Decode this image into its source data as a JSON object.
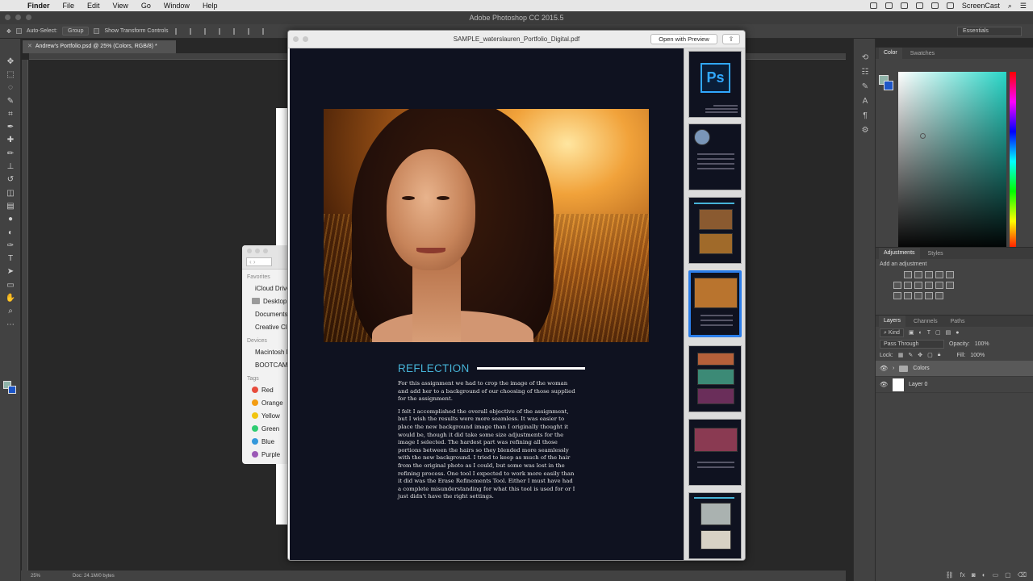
{
  "menubar": {
    "app": "Finder",
    "items": [
      "File",
      "Edit",
      "View",
      "Go",
      "Window",
      "Help"
    ],
    "right_label": "ScreenCast"
  },
  "window": {
    "title": "Adobe Photoshop CC 2015.5"
  },
  "options_bar": {
    "auto_select_label": "Auto-Select:",
    "auto_select_value": "Group",
    "transform_label": "Show Transform Controls",
    "workspace": "Essentials"
  },
  "document_tab": {
    "title": "Andrew's Portfolio.psd @ 25% (Colors, RGB/8) *"
  },
  "statusbar": {
    "zoom": "25%",
    "doc_info": "Doc: 24.1M/0 bytes"
  },
  "tools": {
    "icons": [
      "move-icon",
      "marquee-icon",
      "lasso-icon",
      "quick-select-icon",
      "crop-icon",
      "eyedropper-icon",
      "healing-icon",
      "brush-icon",
      "stamp-icon",
      "history-brush-icon",
      "eraser-icon",
      "gradient-icon",
      "blur-icon",
      "dodge-icon",
      "pen-icon",
      "type-icon",
      "path-select-icon",
      "shape-icon",
      "hand-icon",
      "zoom-icon",
      "more-tools-icon"
    ],
    "glyphs": [
      "✥",
      "⬚",
      "◌",
      "✎",
      "⌗",
      "✒",
      "✚",
      "✏",
      "⊥",
      "↺",
      "◫",
      "▤",
      "●",
      "◐",
      "✑",
      "T",
      "➤",
      "▭",
      "✋",
      "⌕",
      "⋯"
    ]
  },
  "colors": {
    "foreground": "#8fb3a8",
    "background": "#1d56c8",
    "picker_hue": "#29d6c7",
    "accent_blue": "#2b7de9",
    "reflection_teal": "#46b4d8"
  },
  "color_panel": {
    "tabs": [
      "Color",
      "Swatches"
    ]
  },
  "adjustments_panel": {
    "tabs": [
      "Adjustments",
      "Styles"
    ],
    "subtitle": "Add an adjustment"
  },
  "layers_panel": {
    "tabs": [
      "Layers",
      "Channels",
      "Paths"
    ],
    "filter_label": "Kind",
    "blend_mode": "Pass Through",
    "opacity_label": "Opacity:",
    "opacity_value": "100%",
    "lock_label": "Lock:",
    "fill_label": "Fill:",
    "fill_value": "100%",
    "layers": [
      {
        "name": "Colors",
        "type": "group"
      },
      {
        "name": "Layer 0",
        "type": "layer"
      }
    ]
  },
  "finder": {
    "favorites_header": "Favorites",
    "favorites": [
      "iCloud Drive",
      "Desktop",
      "Documents",
      "Creative Cloud Files"
    ],
    "devices_header": "Devices",
    "devices": [
      "Macintosh HD",
      "BOOTCAMP"
    ],
    "tags_header": "Tags",
    "tags": [
      {
        "name": "Red",
        "color": "#e74c3c"
      },
      {
        "name": "Orange",
        "color": "#f39c12"
      },
      {
        "name": "Yellow",
        "color": "#f1c40f"
      },
      {
        "name": "Green",
        "color": "#2ecc71"
      },
      {
        "name": "Blue",
        "color": "#3498db"
      },
      {
        "name": "Purple",
        "color": "#9b59b6"
      }
    ]
  },
  "preview": {
    "title": "SAMPLE_waterslauren_Portfolio_Digital.pdf",
    "open_button": "Open with Preview",
    "ps_glyph": "Ps",
    "heading": "REFLECTION",
    "paragraph1": "For this assignment we had to crop the image of the woman and add her to a background of our choosing of those supplied for the assignment.",
    "paragraph2": "I felt I accomplished the overall objective of the assignment, but I wish the results were more seamless. It was easier to place the new background image than I originally thought it would be, though it did take some size adjustments for the image I selected. The hardest part was refining all those portions between the hairs so they blended more seamlessly with the new background. I tried to keep as much of the hair from the original photo as I could, but some was lost in the refining process. One tool I expected to work more easily than it did was the Erase Refinements Tool. Either I must have had a complete misunderstanding for what this tool is used for or I just didn't have the right settings.",
    "selected_thumbnail": 4
  }
}
